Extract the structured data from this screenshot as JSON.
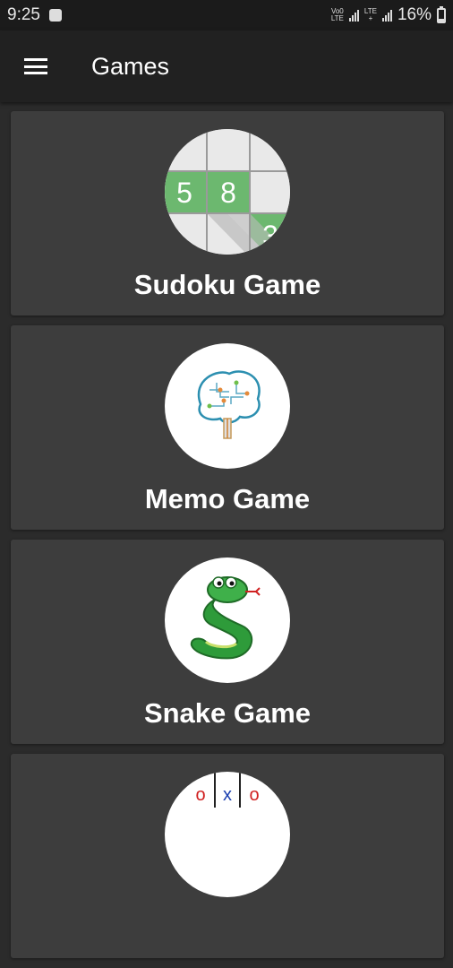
{
  "status_bar": {
    "time": "9:25",
    "network_tag_1_top": "Vo0",
    "network_tag_1_bottom": "LTE",
    "network_tag_2_top": "LTE",
    "network_tag_2_bottom": "+",
    "battery_percent": "16%",
    "battery_level": 0.16
  },
  "app_bar": {
    "title": "Games"
  },
  "games": [
    {
      "label": "Sudoku Game",
      "icon": "sudoku-icon",
      "digits": [
        "5",
        "8",
        "3"
      ],
      "accent": "#6cb86f"
    },
    {
      "label": "Memo Game",
      "icon": "brain-icon"
    },
    {
      "label": "Snake Game",
      "icon": "snake-icon",
      "accent": "#2e9b3a"
    },
    {
      "label": "",
      "icon": "tic-tac-toe-icon",
      "symbols": [
        "o",
        "x",
        "o"
      ]
    }
  ]
}
